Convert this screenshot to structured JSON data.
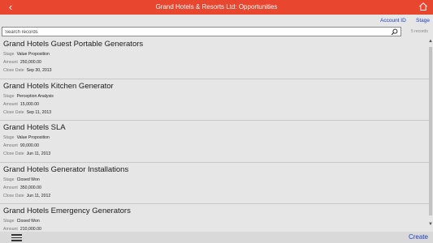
{
  "header": {
    "title": "Grand Hotels & Resorts Ltd: Opportunities",
    "back_icon": "back-arrow-icon",
    "home_icon": "home-icon"
  },
  "sort": {
    "account_id": "Account ID",
    "stage": "Stage"
  },
  "search": {
    "placeholder": "Search records",
    "count": "5 records"
  },
  "labels": {
    "stage": "Stage",
    "amount": "Amount",
    "close_date": "Close Date"
  },
  "records": [
    {
      "name": "Grand Hotels Guest Portable Generators",
      "stage": "Value Proposition",
      "amount": "250,000.00",
      "close_date": "Sep 30, 2013"
    },
    {
      "name": "Grand Hotels Kitchen Generator",
      "stage": "Perception Analysis",
      "amount": "15,000.00",
      "close_date": "Sep 11, 2013"
    },
    {
      "name": "Grand Hotels SLA",
      "stage": "Value Proposition",
      "amount": "90,000.00",
      "close_date": "Jun 11, 2013"
    },
    {
      "name": "Grand Hotels Generator Installations",
      "stage": "Closed Won",
      "amount": "350,000.00",
      "close_date": "Jun 11, 2012"
    },
    {
      "name": "Grand Hotels Emergency Generators",
      "stage": "Closed Won",
      "amount": "210,000.00",
      "close_date": ""
    }
  ],
  "footer": {
    "menu_icon": "hamburger-menu-icon",
    "create_label": "Create"
  },
  "colors": {
    "header_bg": "#e8462e",
    "link": "#1a3fbf",
    "background": "#e6e6e6"
  }
}
